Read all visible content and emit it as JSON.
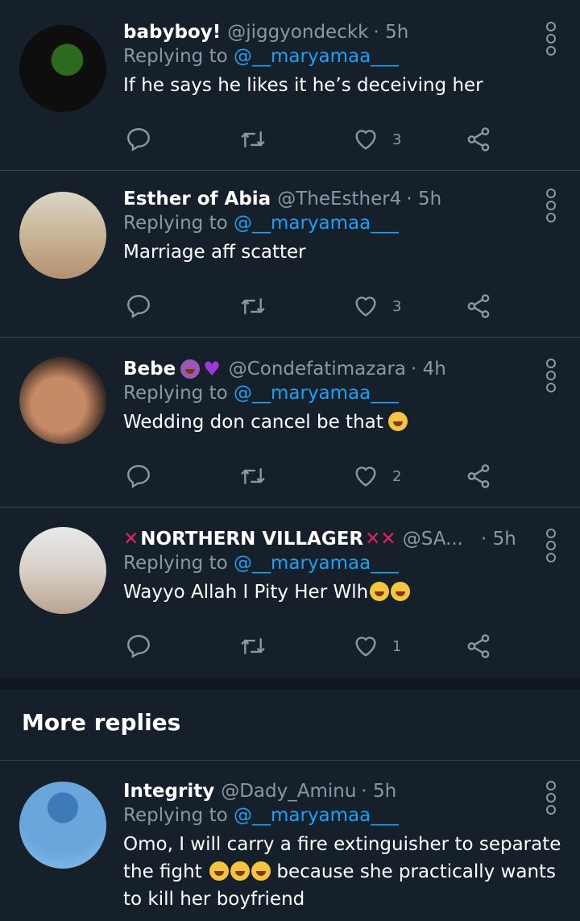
{
  "tweets": [
    {
      "name": "babyboy!",
      "handle": "@jiggyondeckk",
      "time": "· 5h",
      "replying_prefix": "Replying to",
      "replying_to": "@__maryamaa___",
      "text": "If he says he likes it he’s deceiving her",
      "likes": "3"
    },
    {
      "name": "Esther of Abia",
      "handle": "@TheEsther4",
      "time": "· 5h",
      "replying_prefix": "Replying to",
      "replying_to": "@__maryamaa___",
      "text": "Marriage aff scatter",
      "likes": "3"
    },
    {
      "name": "Bebe",
      "handle": "@Condefatimazara",
      "time": "· 4h",
      "replying_prefix": "Replying to",
      "replying_to": "@__maryamaa___",
      "text": "Wedding don cancel be that",
      "likes": "2"
    },
    {
      "name": "NORTHERN VILLAGER",
      "handle": "@SA...",
      "time": "· 5h",
      "replying_prefix": "Replying to",
      "replying_to": "@__maryamaa___",
      "text": "Wayyo Allah I Pity Her Wlh",
      "likes": "1"
    }
  ],
  "section_title": "More replies",
  "more_tweet": {
    "name": "Integrity",
    "handle": "@Dady_Aminu",
    "time": "· 5h",
    "replying_prefix": "Replying to",
    "replying_to": "@__maryamaa___",
    "text_line1": "Omo, I will carry a fire extinguisher to separate",
    "text_line2a": "the fight",
    "text_line2b": "because she practically wants",
    "text_line3": "to kill her boyfriend"
  },
  "icons": {
    "reply": "reply-icon",
    "retweet": "retweet-icon",
    "like": "heart-icon",
    "share": "share-icon",
    "more": "more-options-icon"
  },
  "colors": {
    "background": "#15202b",
    "secondary_text": "#8899a6",
    "mention": "#1da1f2",
    "divider": "#38444d"
  }
}
